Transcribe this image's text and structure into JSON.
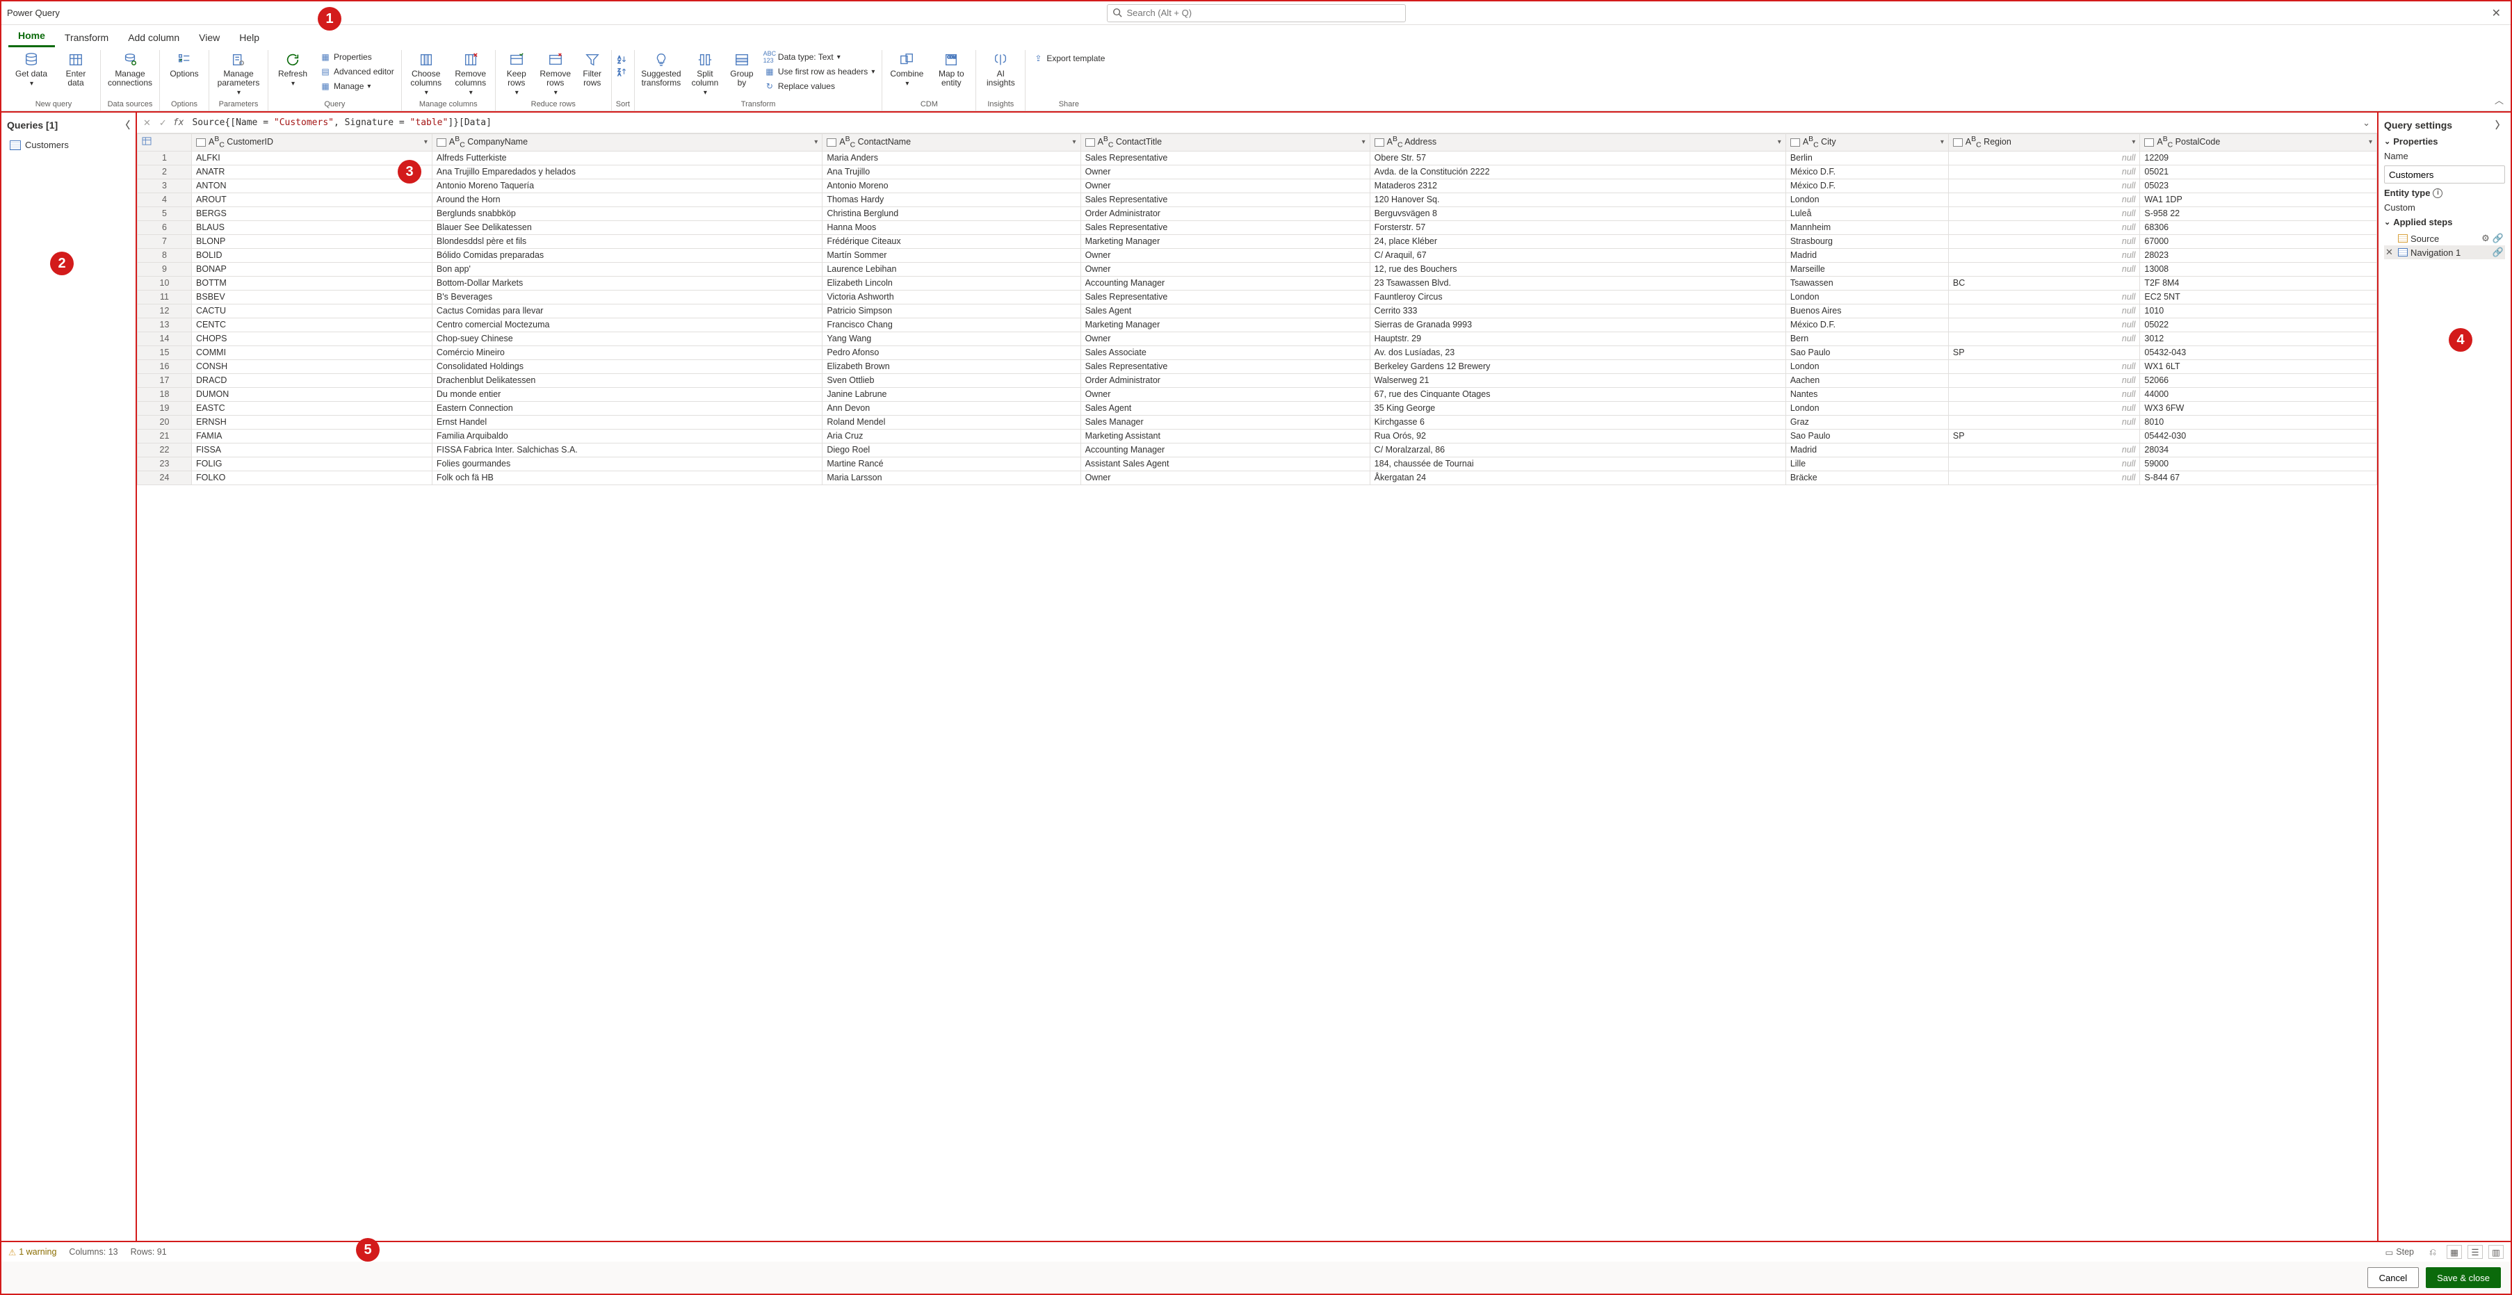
{
  "title": "Power Query",
  "search_placeholder": "Search (Alt + Q)",
  "tabs": [
    "Home",
    "Transform",
    "Add column",
    "View",
    "Help"
  ],
  "ribbon": {
    "new_query": {
      "label": "New query",
      "get_data": "Get data",
      "enter_data": "Enter data"
    },
    "data_sources": {
      "label": "Data sources",
      "manage_connections": "Manage connections"
    },
    "options": {
      "label": "Options",
      "options": "Options"
    },
    "parameters": {
      "label": "Parameters",
      "manage_parameters": "Manage parameters"
    },
    "query": {
      "label": "Query",
      "refresh": "Refresh",
      "properties": "Properties",
      "advanced_editor": "Advanced editor",
      "manage": "Manage"
    },
    "manage_columns": {
      "label": "Manage columns",
      "choose": "Choose columns",
      "remove": "Remove columns"
    },
    "reduce_rows": {
      "label": "Reduce rows",
      "keep": "Keep rows",
      "remove": "Remove rows",
      "filter": "Filter rows"
    },
    "sort": {
      "label": "Sort"
    },
    "transform": {
      "label": "Transform",
      "suggested": "Suggested transforms",
      "split": "Split column",
      "group": "Group by",
      "datatype": "Data type: Text",
      "firstrow": "Use first row as headers",
      "replace": "Replace values"
    },
    "cdm": {
      "label": "CDM",
      "combine": "Combine",
      "map": "Map to entity"
    },
    "insights": {
      "label": "Insights",
      "ai": "AI insights"
    },
    "share": {
      "label": "Share",
      "export": "Export template"
    }
  },
  "queries": {
    "header": "Queries [1]",
    "items": [
      "Customers"
    ]
  },
  "formula": {
    "prefix": "Source{[Name = ",
    "s1": "\"Customers\"",
    "mid": ", Signature = ",
    "s2": "\"table\"",
    "suffix": "]}[Data]"
  },
  "columns": [
    "CustomerID",
    "CompanyName",
    "ContactName",
    "ContactTitle",
    "Address",
    "City",
    "Region",
    "PostalCode"
  ],
  "rows": [
    [
      "ALFKI",
      "Alfreds Futterkiste",
      "Maria Anders",
      "Sales Representative",
      "Obere Str. 57",
      "Berlin",
      null,
      "12209"
    ],
    [
      "ANATR",
      "Ana Trujillo Emparedados y helados",
      "Ana Trujillo",
      "Owner",
      "Avda. de la Constitución 2222",
      "México D.F.",
      null,
      "05021"
    ],
    [
      "ANTON",
      "Antonio Moreno Taquería",
      "Antonio Moreno",
      "Owner",
      "Mataderos  2312",
      "México D.F.",
      null,
      "05023"
    ],
    [
      "AROUT",
      "Around the Horn",
      "Thomas Hardy",
      "Sales Representative",
      "120 Hanover Sq.",
      "London",
      null,
      "WA1 1DP"
    ],
    [
      "BERGS",
      "Berglunds snabbköp",
      "Christina Berglund",
      "Order Administrator",
      "Berguvsvägen  8",
      "Luleå",
      null,
      "S-958 22"
    ],
    [
      "BLAUS",
      "Blauer See Delikatessen",
      "Hanna Moos",
      "Sales Representative",
      "Forsterstr. 57",
      "Mannheim",
      null,
      "68306"
    ],
    [
      "BLONP",
      "Blondesddsl père et fils",
      "Frédérique Citeaux",
      "Marketing Manager",
      "24, place Kléber",
      "Strasbourg",
      null,
      "67000"
    ],
    [
      "BOLID",
      "Bólido Comidas preparadas",
      "Martín Sommer",
      "Owner",
      "C/ Araquil, 67",
      "Madrid",
      null,
      "28023"
    ],
    [
      "BONAP",
      "Bon app'",
      "Laurence Lebihan",
      "Owner",
      "12, rue des Bouchers",
      "Marseille",
      null,
      "13008"
    ],
    [
      "BOTTM",
      "Bottom-Dollar Markets",
      "Elizabeth Lincoln",
      "Accounting Manager",
      "23 Tsawassen Blvd.",
      "Tsawassen",
      "BC",
      "T2F 8M4"
    ],
    [
      "BSBEV",
      "B's Beverages",
      "Victoria Ashworth",
      "Sales Representative",
      "Fauntleroy Circus",
      "London",
      null,
      "EC2 5NT"
    ],
    [
      "CACTU",
      "Cactus Comidas para llevar",
      "Patricio Simpson",
      "Sales Agent",
      "Cerrito 333",
      "Buenos Aires",
      null,
      "1010"
    ],
    [
      "CENTC",
      "Centro comercial Moctezuma",
      "Francisco Chang",
      "Marketing Manager",
      "Sierras de Granada 9993",
      "México D.F.",
      null,
      "05022"
    ],
    [
      "CHOPS",
      "Chop-suey Chinese",
      "Yang Wang",
      "Owner",
      "Hauptstr. 29",
      "Bern",
      null,
      "3012"
    ],
    [
      "COMMI",
      "Comércio Mineiro",
      "Pedro Afonso",
      "Sales Associate",
      "Av. dos Lusíadas, 23",
      "Sao Paulo",
      "SP",
      "05432-043"
    ],
    [
      "CONSH",
      "Consolidated Holdings",
      "Elizabeth Brown",
      "Sales Representative",
      "Berkeley Gardens 12  Brewery",
      "London",
      null,
      "WX1 6LT"
    ],
    [
      "DRACD",
      "Drachenblut Delikatessen",
      "Sven Ottlieb",
      "Order Administrator",
      "Walserweg 21",
      "Aachen",
      null,
      "52066"
    ],
    [
      "DUMON",
      "Du monde entier",
      "Janine Labrune",
      "Owner",
      "67, rue des Cinquante Otages",
      "Nantes",
      null,
      "44000"
    ],
    [
      "EASTC",
      "Eastern Connection",
      "Ann Devon",
      "Sales Agent",
      "35 King George",
      "London",
      null,
      "WX3 6FW"
    ],
    [
      "ERNSH",
      "Ernst Handel",
      "Roland Mendel",
      "Sales Manager",
      "Kirchgasse 6",
      "Graz",
      null,
      "8010"
    ],
    [
      "FAMIA",
      "Familia Arquibaldo",
      "Aria Cruz",
      "Marketing Assistant",
      "Rua Orós, 92",
      "Sao Paulo",
      "SP",
      "05442-030"
    ],
    [
      "FISSA",
      "FISSA Fabrica Inter. Salchichas S.A.",
      "Diego Roel",
      "Accounting Manager",
      "C/ Moralzarzal, 86",
      "Madrid",
      null,
      "28034"
    ],
    [
      "FOLIG",
      "Folies gourmandes",
      "Martine Rancé",
      "Assistant Sales Agent",
      "184, chaussée de Tournai",
      "Lille",
      null,
      "59000"
    ],
    [
      "FOLKO",
      "Folk och fä HB",
      "Maria Larsson",
      "Owner",
      "Åkergatan 24",
      "Bräcke",
      null,
      "S-844 67"
    ]
  ],
  "settings": {
    "header": "Query settings",
    "properties_label": "Properties",
    "name_label": "Name",
    "name_value": "Customers",
    "entity_type_label": "Entity type",
    "entity_type_value": "Custom",
    "applied_steps_label": "Applied steps",
    "steps": [
      "Source",
      "Navigation 1"
    ]
  },
  "status": {
    "warning": "1 warning",
    "cols": "Columns: 13",
    "rows": "Rows: 91",
    "step": "Step"
  },
  "footer": {
    "cancel": "Cancel",
    "save": "Save & close"
  },
  "null_text": "null",
  "annotations": {
    "a1": "1",
    "a2": "2",
    "a3": "3",
    "a4": "4",
    "a5": "5"
  }
}
